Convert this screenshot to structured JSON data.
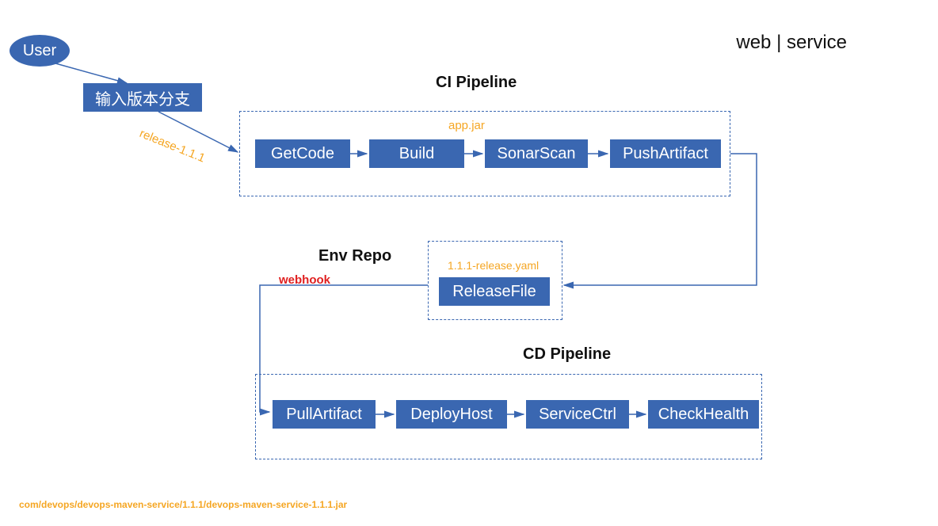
{
  "header": {
    "title": "web | service"
  },
  "user": {
    "label": "User"
  },
  "input_branch": {
    "label": "输入版本分支"
  },
  "labels": {
    "release": "release-1.1.1",
    "appjar": "app.jar",
    "release_yaml": "1.1.1-release.yaml",
    "webhook": "webhook"
  },
  "ci": {
    "title": "CI Pipeline",
    "steps": [
      "GetCode",
      "Build",
      "SonarScan",
      "PushArtifact"
    ]
  },
  "env": {
    "title": "Env Repo",
    "steps": [
      "ReleaseFile"
    ]
  },
  "cd": {
    "title": "CD Pipeline",
    "steps": [
      "PullArtifact",
      "DeployHost",
      "ServiceCtrl",
      "CheckHealth"
    ]
  },
  "footer": {
    "path": "com/devops/devops-maven-service/1.1.1/devops-maven-service-1.1.1.jar"
  }
}
